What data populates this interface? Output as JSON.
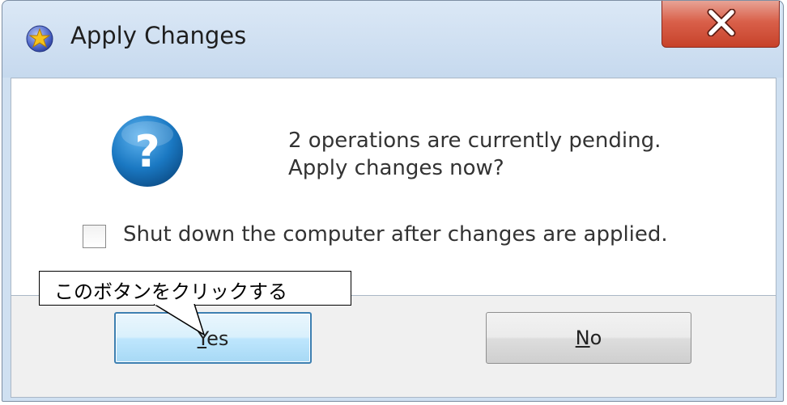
{
  "window": {
    "title": "Apply Changes",
    "icons": {
      "app": "star-shield-icon",
      "close": "close-x-icon"
    }
  },
  "dialog": {
    "icon": "question-mark-icon",
    "message_line1": "2 operations are currently pending.",
    "message_line2": "Apply changes now?",
    "shutdown_checkbox": {
      "label": "Shut down the computer after changes are applied.",
      "checked": false
    }
  },
  "buttons": {
    "yes": {
      "mnemonic": "Y",
      "rest": "es"
    },
    "no": {
      "mnemonic": "N",
      "rest": "o"
    }
  },
  "callout": {
    "text": "このボタンをクリックする"
  },
  "colors": {
    "close_button": "#c7422a",
    "default_button_border": "#3c7fb1",
    "question_icon": "#1a78c2"
  }
}
